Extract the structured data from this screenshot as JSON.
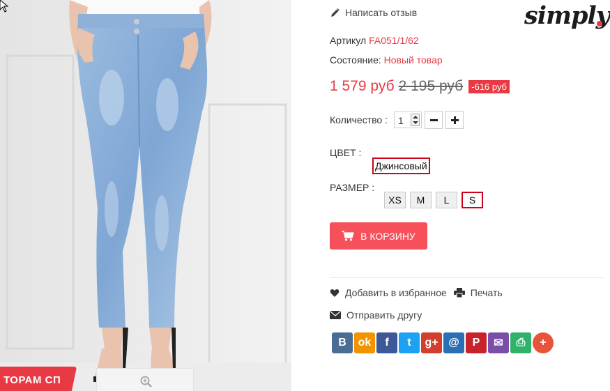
{
  "product": {
    "promo_label": "ТОРАМ СП"
  },
  "review": {
    "label": "Написать отзыв"
  },
  "brand": {
    "logo_text": "simply"
  },
  "sku": {
    "label": "Артикул",
    "value": "FA051/1/62"
  },
  "condition": {
    "label": "Состояние:",
    "value": "Новый товар"
  },
  "price": {
    "current": "1 579 руб",
    "old": "2 195 руб",
    "discount": "-616 руб"
  },
  "quantity": {
    "label": "Количество :",
    "value": "1"
  },
  "color": {
    "label": "ЦВЕТ :",
    "selected": "Джинсовый"
  },
  "size": {
    "label": "РАЗМЕР :",
    "options": [
      "XS",
      "M",
      "L",
      "S"
    ],
    "selected": "S"
  },
  "cart_button": {
    "label": "В КОРЗИНУ"
  },
  "actions": {
    "wishlist": "Добавить в избранное",
    "print": "Печать",
    "send": "Отправить другу"
  },
  "share": [
    {
      "name": "vk-icon",
      "glyph": "В",
      "color": "#4a6d96"
    },
    {
      "name": "odnoklassniki-icon",
      "glyph": "ok",
      "color": "#f29400"
    },
    {
      "name": "facebook-icon",
      "glyph": "f",
      "color": "#3b5998"
    },
    {
      "name": "twitter-icon",
      "glyph": "t",
      "color": "#1da1f2"
    },
    {
      "name": "googleplus-icon",
      "glyph": "g+",
      "color": "#d23f2f"
    },
    {
      "name": "mailru-icon",
      "glyph": "@",
      "color": "#2a6fb4"
    },
    {
      "name": "pinterest-icon",
      "glyph": "P",
      "color": "#c8232c"
    },
    {
      "name": "email-icon",
      "glyph": "✉",
      "color": "#7a4fa8"
    },
    {
      "name": "print-share-icon",
      "glyph": "⎙",
      "color": "#2fb36a"
    },
    {
      "name": "more-share-icon",
      "glyph": "+",
      "color": "#e8543a"
    }
  ],
  "colors": {
    "accent": "#e83a44",
    "button": "#f6505b",
    "selected_border": "#d0021b"
  }
}
